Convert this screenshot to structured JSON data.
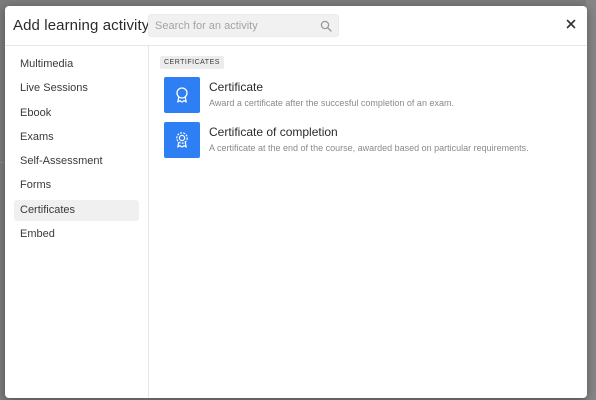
{
  "modal": {
    "title": "Add learning activity",
    "search_placeholder": "Search for an activity",
    "search_value": ""
  },
  "sidebar": {
    "items": [
      {
        "label": "Multimedia"
      },
      {
        "label": "Live Sessions"
      },
      {
        "label": "Ebook"
      },
      {
        "label": "Exams"
      },
      {
        "label": "Self-Assessment"
      },
      {
        "label": "Forms"
      },
      {
        "label": "Certificates",
        "active": true
      },
      {
        "label": "Embed"
      }
    ]
  },
  "content": {
    "section_tag": "CERTIFICATES",
    "activities": [
      {
        "title": "Certificate",
        "description": "Award a certificate after the succesful completion of an exam.",
        "icon": "award-ribbon-icon"
      },
      {
        "title": "Certificate of completion",
        "description": "A certificate at the end of the course, awarded based on particular requirements.",
        "icon": "seal-ribbon-icon"
      }
    ]
  },
  "colors": {
    "accent": "#2d7ff3",
    "overlay": "#7c7c7c",
    "active_bg": "#f0f0f0"
  }
}
